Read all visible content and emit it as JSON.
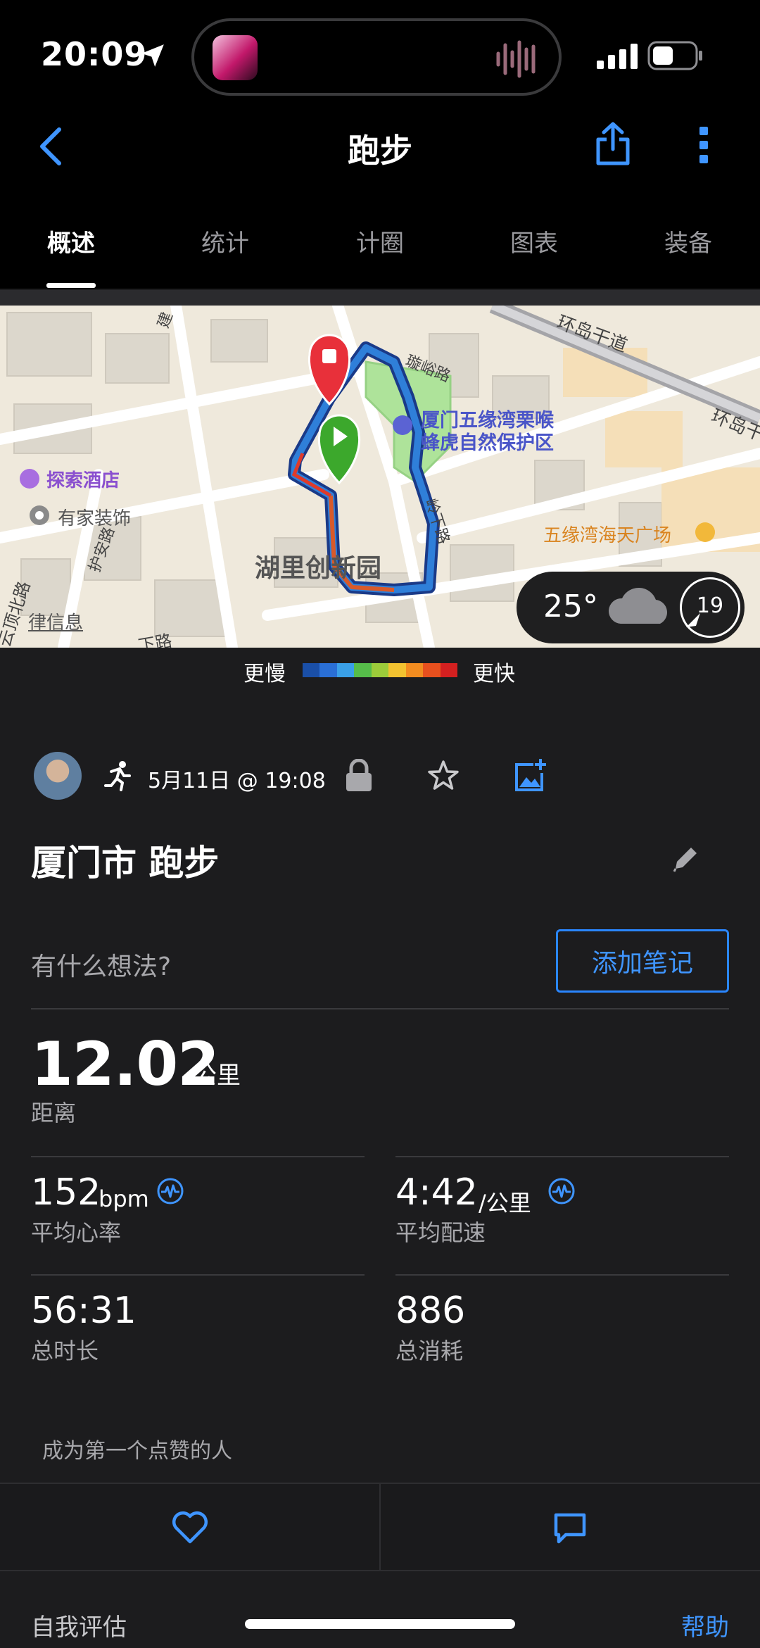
{
  "status": {
    "time": "20:09"
  },
  "nav": {
    "title": "跑步"
  },
  "tabs": [
    "概述",
    "统计",
    "计圈",
    "图表",
    "装备"
  ],
  "map": {
    "labels": {
      "road_huandao": "环岛干道",
      "road_huandao2": "环岛干",
      "road_top": "璇峪路",
      "road_right": "岭下路",
      "road_left1": "护安路",
      "road_left2": "云顶北路",
      "road_bottom": "下路",
      "park": "厦门五缘湾栗喉蜂虎自然保护区",
      "park_line1": "厦门五缘湾栗喉",
      "park_line2": "蜂虎自然保护区",
      "hotel": "探索酒店",
      "decor": "有家装饰",
      "info": "律信息",
      "area": "湖里创新园",
      "mall": "五缘湾海天广场",
      "edge_top": "建"
    },
    "weather": {
      "temp": "25°",
      "wind": "19"
    }
  },
  "legend": {
    "slow": "更慢",
    "fast": "更快",
    "colors": [
      "#1a4fa8",
      "#2a6fd6",
      "#3aa0e8",
      "#56bd4a",
      "#9ccc3a",
      "#f2c230",
      "#f28c20",
      "#e8501e",
      "#d42020"
    ]
  },
  "activity": {
    "date": "5月11日 @ 19:08",
    "title": "厦门市 跑步",
    "notes_prompt": "有什么想法?",
    "notes_button": "添加笔记"
  },
  "stats": {
    "distance": {
      "value": "12.02",
      "unit": "公里",
      "label": "距离"
    },
    "heart_rate": {
      "value": "152",
      "unit": "bpm",
      "label": "平均心率"
    },
    "pace": {
      "value": "4:42",
      "unit": "/公里",
      "label": "平均配速"
    },
    "duration": {
      "value": "56:31",
      "label": "总时长"
    },
    "calories": {
      "value": "886",
      "label": "总消耗"
    }
  },
  "social": {
    "like_prompt": "成为第一个点赞的人"
  },
  "footer": {
    "self_eval": "自我评估",
    "help": "帮助"
  },
  "colors": {
    "accent": "#3f95ff",
    "background": "#1c1c1e",
    "start": "#3ca82c",
    "end": "#e8303a"
  }
}
